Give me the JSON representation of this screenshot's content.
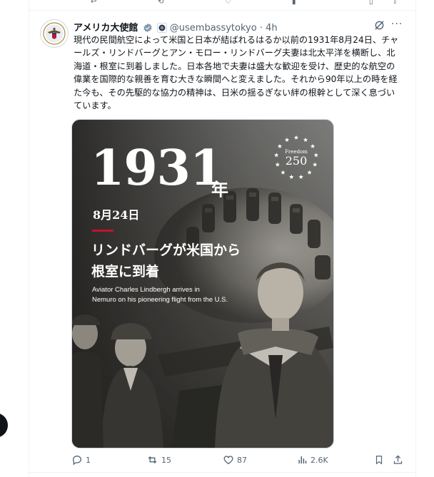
{
  "tweet": {
    "author_name": "アメリカ大使館",
    "handle": "@usembassytokyo",
    "separator": "·",
    "time": "4h",
    "text": "現代の民間航空によって米国と日本が結ばれるはるか以前の1931年8月24日、チャールズ・リンドバーグとアン・モロー・リンドバーグ夫妻は北太平洋を横断し、北海道・根室に到着しました。日本各地で夫妻は盛大な歓迎を受け、歴史的な航空の偉業を国際的な親善を育む大きな瞬間へと変えました。それから90年以上の時を経た今も、その先駆的な協力の精神は、日米の揺るぎない絆の根幹として深く息づいています。"
  },
  "media": {
    "year": "1931",
    "year_suffix": "年",
    "date": "8月24日",
    "headline_line1": "リンドバーグが米国から",
    "headline_line2": "根室に到着",
    "subtitle_line1": "Aviator Charles Lindbergh arrives in",
    "subtitle_line2": "Nemuro on his pioneering flight from the U.S.",
    "badge_top": "Freedom",
    "badge_num": "250"
  },
  "actions": {
    "replies": "1",
    "reposts": "15",
    "likes": "87",
    "views": "2.6K"
  },
  "icons": {
    "verified": "verified-badge-icon",
    "gov": "government-affiliation-icon",
    "grok": "grok-icon",
    "more": "more-icon",
    "reply": "reply-icon",
    "repost": "repost-icon",
    "like": "like-icon",
    "views": "views-icon",
    "bookmark": "bookmark-icon",
    "share": "share-icon"
  },
  "colors": {
    "text_primary": "#0f1419",
    "text_secondary": "#536471",
    "accent_red": "#c8102e",
    "verified_gray": "#829aab"
  }
}
